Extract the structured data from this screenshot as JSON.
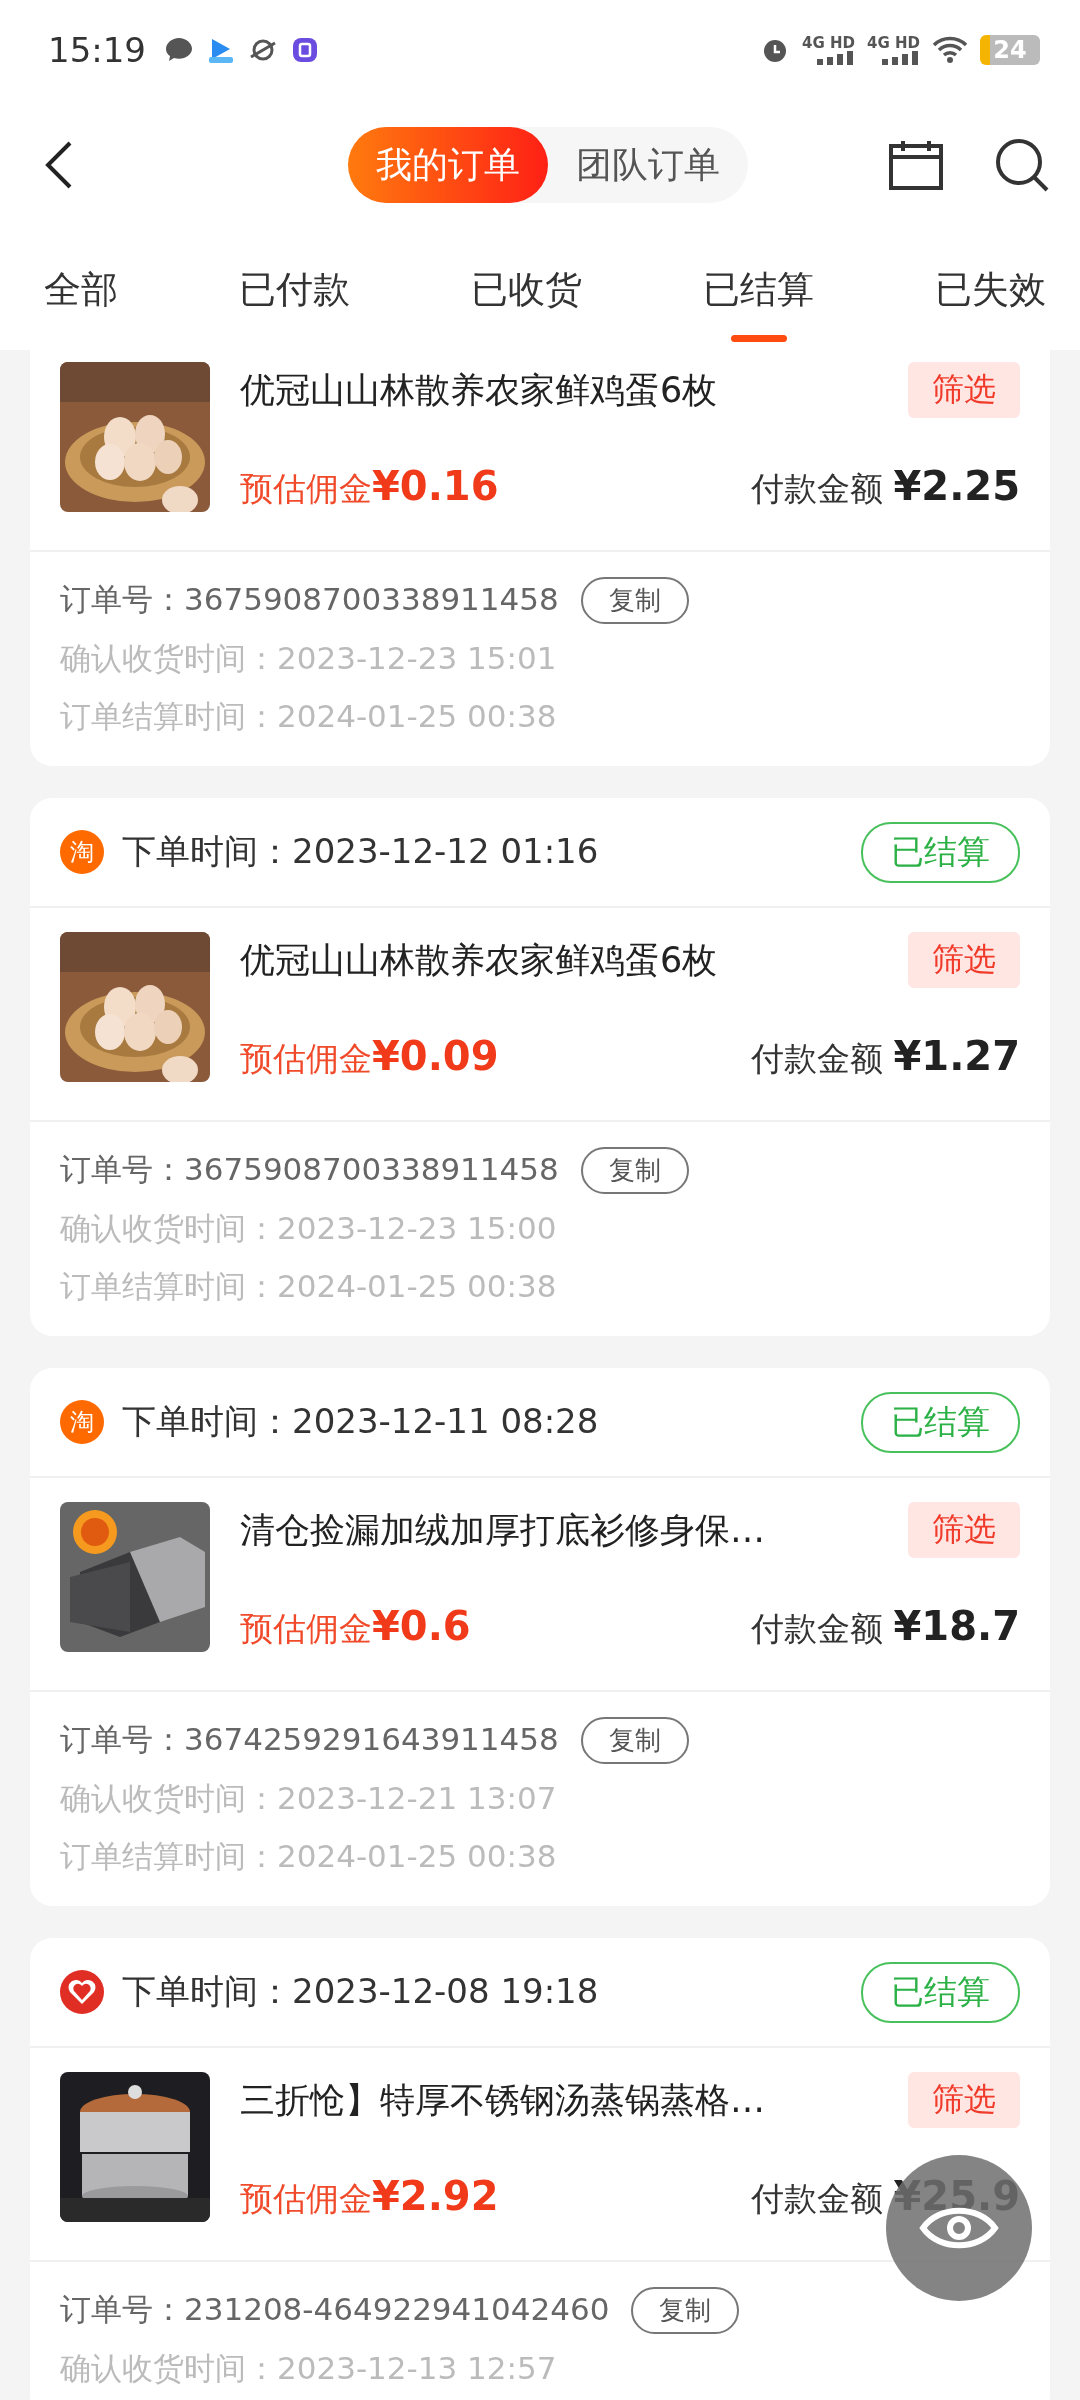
{
  "status_bar": {
    "time": "15:19",
    "network": [
      "4G HD",
      "4G HD"
    ],
    "battery": "24"
  },
  "header": {
    "segments": [
      {
        "label": "我的订单",
        "selected": true
      },
      {
        "label": "团队订单",
        "selected": false
      }
    ]
  },
  "tabs": [
    {
      "label": "全部",
      "selected": false
    },
    {
      "label": "已付款",
      "selected": false
    },
    {
      "label": "已收货",
      "selected": false
    },
    {
      "label": "已结算",
      "selected": true
    },
    {
      "label": "已失效",
      "selected": false
    }
  ],
  "orders": [
    {
      "product": {
        "kind": "picture",
        "name": "优冠山山林散养农家鲜鸡蛋6枚",
        "filter": "筛选"
      },
      "commission_label": "预估佣金",
      "commission": "¥0.16",
      "paid_label": "付款金额",
      "paid": "¥2.25",
      "order_no_label": "订单号：",
      "order_no": "3675908700338911458",
      "copy": "复制",
      "details": [
        {
          "label": "确认收货时间：",
          "value": "2023-12-23 15:01"
        },
        {
          "label": "订单结算时间：",
          "value": "2024-01-25 00:38"
        }
      ]
    },
    {
      "platform": {
        "kind": "taobao",
        "glyph": "淘"
      },
      "placed_label": "下单时间：",
      "placed": "2023-12-12 01:16",
      "status": "已结算",
      "product": {
        "kind": "picture",
        "name": "优冠山山林散养农家鲜鸡蛋6枚",
        "filter": "筛选"
      },
      "commission_label": "预估佣金",
      "commission": "¥0.09",
      "paid_label": "付款金额",
      "paid": "¥1.27",
      "order_no_label": "订单号：",
      "order_no": "3675908700338911458",
      "copy": "复制",
      "details": [
        {
          "label": "确认收货时间：",
          "value": "2023-12-23 15:00"
        },
        {
          "label": "订单结算时间：",
          "value": "2024-01-25 00:38"
        }
      ]
    },
    {
      "platform": {
        "kind": "taobao",
        "glyph": "淘"
      },
      "placed_label": "下单时间：",
      "placed": "2023-12-11 08:28",
      "status": "已结算",
      "product": {
        "kind": "picture",
        "name": "清仓捡漏加绒加厚打底衫修身保…",
        "filter": "筛选"
      },
      "commission_label": "预估佣金",
      "commission": "¥0.6",
      "paid_label": "付款金额",
      "paid": "¥18.7",
      "order_no_label": "订单号：",
      "order_no": "3674259291643911458",
      "copy": "复制",
      "details": [
        {
          "label": "确认收货时间：",
          "value": "2023-12-21 13:07"
        },
        {
          "label": "订单结算时间：",
          "value": "2024-01-25 00:38"
        }
      ]
    },
    {
      "platform": {
        "kind": "pinduoduo"
      },
      "placed_label": "下单时间：",
      "placed": "2023-12-08 19:18",
      "status": "已结算",
      "product": {
        "kind": "picture",
        "name": "三折怆】特厚不锈钢汤蒸锅蒸格…",
        "filter": "筛选"
      },
      "commission_label": "预估佣金",
      "commission": "¥2.92",
      "paid_label": "付款金额",
      "paid": "¥25.9",
      "order_no_label": "订单号：",
      "order_no": "231208-464922941042460",
      "copy": "复制",
      "details": [
        {
          "label": "确认收货时间：",
          "value": "2023-12-13 12:57"
        }
      ]
    }
  ]
}
